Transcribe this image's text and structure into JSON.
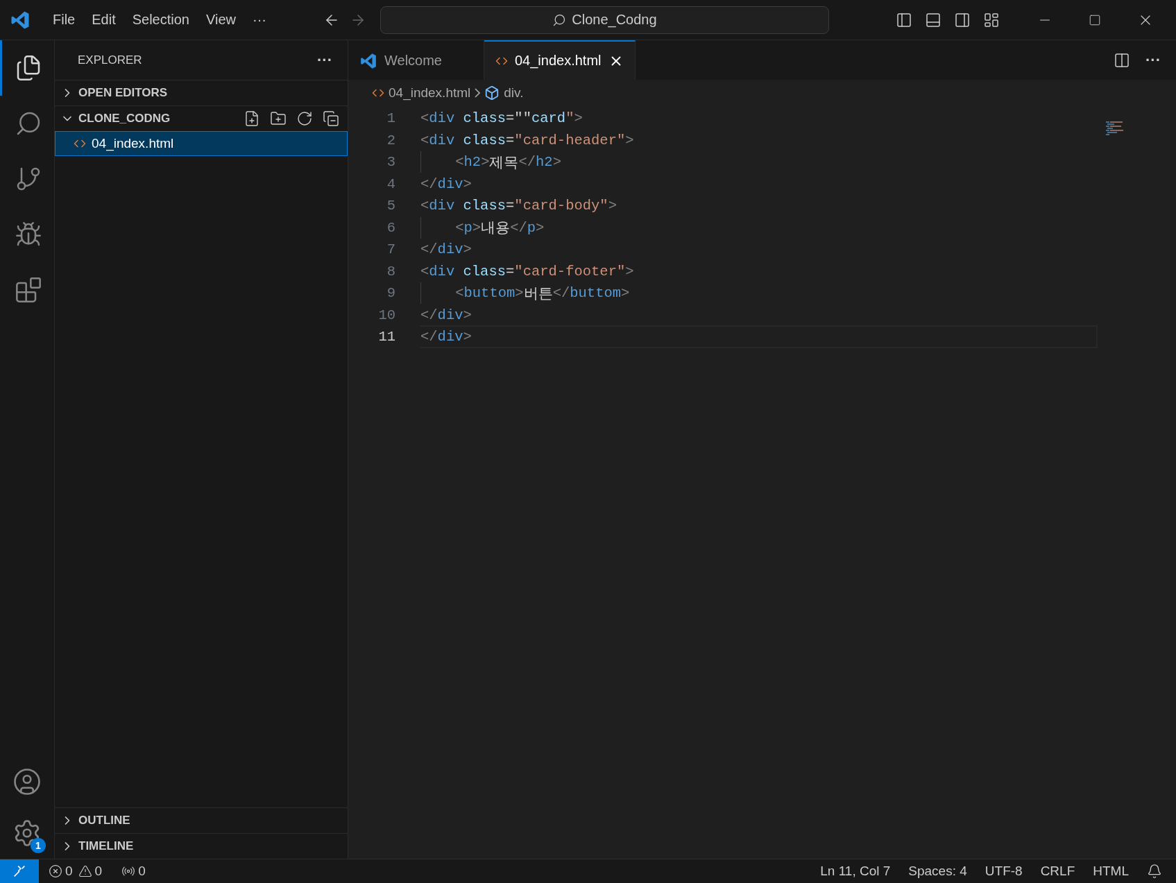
{
  "title_bar": {
    "menu": [
      "File",
      "Edit",
      "Selection",
      "View"
    ],
    "more": "···",
    "search": "Clone_Codng"
  },
  "activity_bar": {
    "items": [
      {
        "kind": "files",
        "selected": true
      },
      {
        "kind": "search",
        "selected": false
      },
      {
        "kind": "branch",
        "selected": false
      },
      {
        "kind": "debug",
        "selected": false
      },
      {
        "kind": "extensions",
        "selected": false
      }
    ],
    "settings_badge": "1"
  },
  "sidebar": {
    "title": "EXPLORER",
    "more": "···",
    "sections": [
      {
        "label": "OPEN EDITORS",
        "expanded": false
      },
      {
        "label": "CLONE_CODNG",
        "expanded": true,
        "files": [
          {
            "name": "04_index.html",
            "selected": true
          }
        ]
      }
    ],
    "bottom_sections": [
      {
        "label": "OUTLINE",
        "expanded": false
      },
      {
        "label": "TIMELINE",
        "expanded": false
      }
    ]
  },
  "tabs": [
    {
      "label": "Welcome",
      "kind": "welcome",
      "selected": false
    },
    {
      "label": "04_index.html",
      "kind": "html",
      "selected": true
    }
  ],
  "tab_more": "···",
  "breadcrumb": [
    "04_index.html",
    "div."
  ],
  "editor": {
    "lines": [
      {
        "number": "1",
        "guide": false,
        "active": false,
        "tokens": [
          {
            "kind": "punct",
            "text": "<"
          },
          {
            "kind": "tag",
            "text": "div"
          },
          {
            "kind": "attr",
            "text": " class"
          },
          {
            "kind": "plain",
            "text": "=\"\""
          },
          {
            "kind": "attr",
            "text": "card"
          },
          {
            "kind": "string",
            "text": "\""
          },
          {
            "kind": "punct",
            "text": ">"
          }
        ]
      },
      {
        "number": "2",
        "guide": false,
        "active": false,
        "tokens": [
          {
            "kind": "punct",
            "text": "<"
          },
          {
            "kind": "tag",
            "text": "div"
          },
          {
            "kind": "attr",
            "text": " class"
          },
          {
            "kind": "plain",
            "text": "="
          },
          {
            "kind": "string",
            "text": "\"card-header\""
          },
          {
            "kind": "punct",
            "text": ">"
          }
        ]
      },
      {
        "number": "3",
        "guide": true,
        "active": false,
        "tokens": [
          {
            "kind": "punct",
            "text": "<"
          },
          {
            "kind": "tag",
            "text": "h2"
          },
          {
            "kind": "punct",
            "text": ">"
          },
          {
            "kind": "plain",
            "text": "제목"
          },
          {
            "kind": "punct",
            "text": "</"
          },
          {
            "kind": "tag",
            "text": "h2"
          },
          {
            "kind": "punct",
            "text": ">"
          }
        ]
      },
      {
        "number": "4",
        "guide": false,
        "active": false,
        "tokens": [
          {
            "kind": "punct",
            "text": "</"
          },
          {
            "kind": "tag",
            "text": "div"
          },
          {
            "kind": "punct",
            "text": ">"
          }
        ]
      },
      {
        "number": "5",
        "guide": false,
        "active": false,
        "tokens": [
          {
            "kind": "punct",
            "text": "<"
          },
          {
            "kind": "tag",
            "text": "div"
          },
          {
            "kind": "attr",
            "text": " class"
          },
          {
            "kind": "plain",
            "text": "="
          },
          {
            "kind": "string",
            "text": "\"card-body\""
          },
          {
            "kind": "punct",
            "text": ">"
          }
        ]
      },
      {
        "number": "6",
        "guide": true,
        "active": false,
        "tokens": [
          {
            "kind": "punct",
            "text": "<"
          },
          {
            "kind": "tag",
            "text": "p"
          },
          {
            "kind": "punct",
            "text": ">"
          },
          {
            "kind": "plain",
            "text": "내용"
          },
          {
            "kind": "punct",
            "text": "</"
          },
          {
            "kind": "tag",
            "text": "p"
          },
          {
            "kind": "punct",
            "text": ">"
          }
        ]
      },
      {
        "number": "7",
        "guide": false,
        "active": false,
        "tokens": [
          {
            "kind": "punct",
            "text": "</"
          },
          {
            "kind": "tag",
            "text": "div"
          },
          {
            "kind": "punct",
            "text": ">"
          }
        ]
      },
      {
        "number": "8",
        "guide": false,
        "active": false,
        "tokens": [
          {
            "kind": "punct",
            "text": "<"
          },
          {
            "kind": "tag",
            "text": "div"
          },
          {
            "kind": "attr",
            "text": " class"
          },
          {
            "kind": "plain",
            "text": "="
          },
          {
            "kind": "string",
            "text": "\"card-footer\""
          },
          {
            "kind": "punct",
            "text": ">"
          }
        ]
      },
      {
        "number": "9",
        "guide": true,
        "active": false,
        "tokens": [
          {
            "kind": "punct",
            "text": "<"
          },
          {
            "kind": "tag",
            "text": "buttom"
          },
          {
            "kind": "punct",
            "text": ">"
          },
          {
            "kind": "plain",
            "text": "버튼"
          },
          {
            "kind": "punct",
            "text": "</"
          },
          {
            "kind": "tag",
            "text": "buttom"
          },
          {
            "kind": "punct",
            "text": ">"
          }
        ]
      },
      {
        "number": "10",
        "guide": false,
        "active": false,
        "tokens": [
          {
            "kind": "punct",
            "text": "</"
          },
          {
            "kind": "tag",
            "text": "div"
          },
          {
            "kind": "punct",
            "text": ">"
          }
        ]
      },
      {
        "number": "11",
        "guide": false,
        "active": true,
        "tokens": [
          {
            "kind": "punct",
            "text": "</"
          },
          {
            "kind": "tag",
            "text": "div"
          },
          {
            "kind": "punct",
            "text": ">"
          }
        ]
      }
    ]
  },
  "status_bar": {
    "errors": "0",
    "warnings": "0",
    "ports": "0",
    "items": [
      "Ln 11, Col 7",
      "Spaces: 4",
      "UTF-8",
      "CRLF",
      "HTML"
    ]
  }
}
